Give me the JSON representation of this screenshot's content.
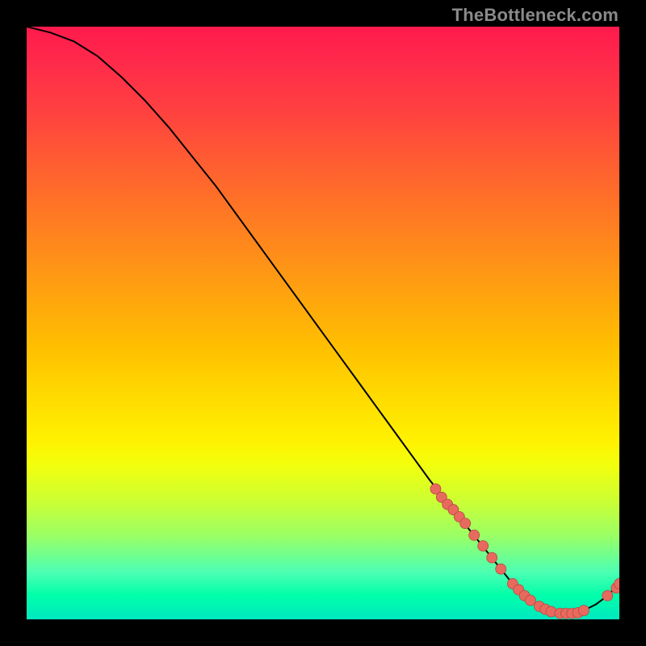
{
  "watermark": "TheBottleneck.com",
  "chart_data": {
    "type": "line",
    "title": "",
    "xlabel": "",
    "ylabel": "",
    "xlim": [
      0,
      100
    ],
    "ylim": [
      0,
      100
    ],
    "x": [
      0,
      4,
      8,
      12,
      16,
      20,
      24,
      28,
      32,
      36,
      40,
      44,
      48,
      52,
      56,
      60,
      64,
      68,
      72,
      76,
      78,
      80,
      82,
      84,
      86,
      88,
      90,
      92,
      94,
      96,
      98,
      100
    ],
    "series": [
      {
        "name": "bottleneck-curve",
        "values": [
          100,
          99,
          97.5,
          95,
          91.5,
          87.5,
          83,
          78,
          73,
          67.5,
          62,
          56.5,
          51,
          45.5,
          40,
          34.5,
          29,
          23.5,
          18.5,
          13.5,
          11,
          8.5,
          6,
          4,
          2.5,
          1.5,
          1,
          1,
          1.5,
          2.5,
          4,
          6
        ]
      }
    ],
    "markers": {
      "name": "highlight-dots",
      "x": [
        69,
        70,
        71,
        72,
        73,
        74,
        75.5,
        77,
        78.5,
        80,
        82,
        83,
        84,
        85,
        86.5,
        87.5,
        88.5,
        90,
        91,
        92,
        93,
        94,
        98,
        99.5,
        100
      ],
      "y": [
        22,
        20.6,
        19.4,
        18.5,
        17.3,
        16.2,
        14.2,
        12.4,
        10.4,
        8.5,
        6,
        5,
        4,
        3.2,
        2.2,
        1.7,
        1.3,
        1,
        1,
        1,
        1.1,
        1.5,
        4,
        5.3,
        6
      ]
    }
  }
}
